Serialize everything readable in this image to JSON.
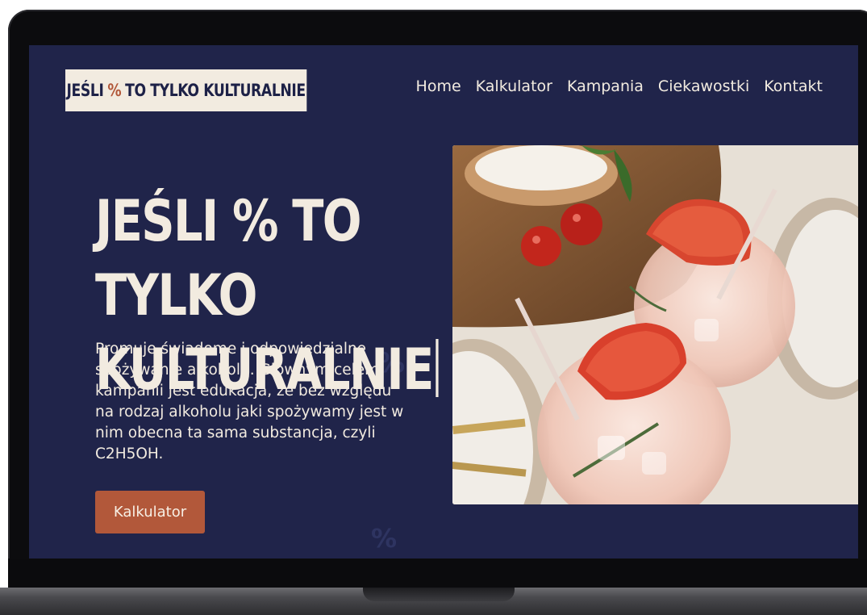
{
  "logo": {
    "before": "JEŚLI",
    "pct": "%",
    "after": "TO TYLKO KULTURALNIE"
  },
  "nav": [
    "Home",
    "Kalkulator",
    "Kampania",
    "Ciekawostki",
    "Kontakt"
  ],
  "hero": {
    "title_line1": "JEŚLI % TO TYLKO",
    "title_line2": "KULTURALNIE",
    "description": "Promuje świadome i odpowiedzialne spożywanie alkoholu. Głównym celem kampanii jest edukacja, że bez względu na rodzaj alkoholu jaki spożywamy jest w nim obecna ta sama substancja, czyli C2H5OH.",
    "cta_label": "Kalkulator"
  },
  "decor": {
    "percent_1": "%",
    "percent_2": "%"
  },
  "colors": {
    "background": "#20244a",
    "accent": "#b2583a",
    "text": "#f2ebe0"
  }
}
